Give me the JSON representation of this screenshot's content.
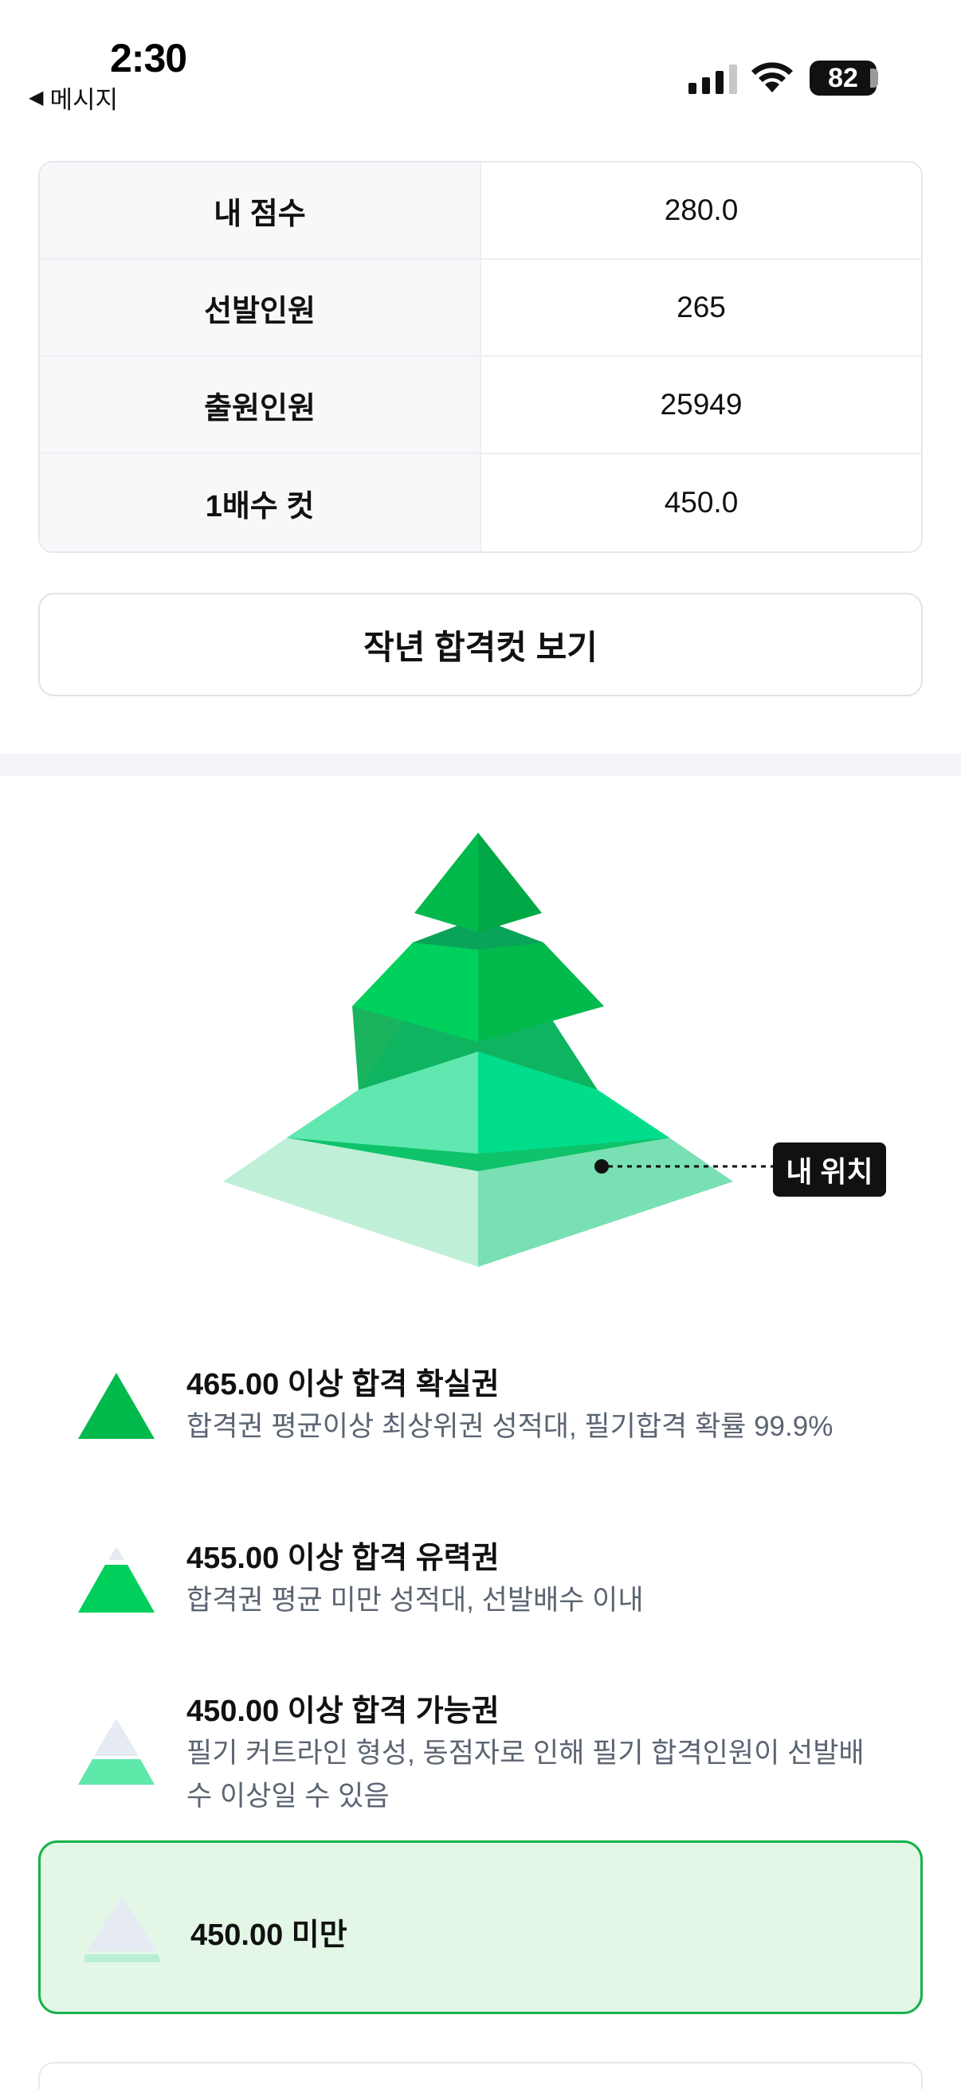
{
  "status_bar": {
    "time": "2:30",
    "back_label": "메시지",
    "battery": "82"
  },
  "score_table": [
    {
      "key": "내 점수",
      "value": "280.0"
    },
    {
      "key": "선발인원",
      "value": "265"
    },
    {
      "key": "출원인원",
      "value": "25949"
    },
    {
      "key": "1배수 컷",
      "value": "450.0"
    }
  ],
  "last_year_button": "작년 합격컷 보기",
  "pyramid": {
    "my_position_label": "내 위치"
  },
  "colors": {
    "accent": "#16b24a",
    "tier1": "#02b94c",
    "tier2": "#00cf5c",
    "tier3": "#3fe2a0",
    "tier4": "#c0efd8"
  },
  "legend": [
    {
      "title": "465.00 이상 합격 확실권",
      "desc": "합격권 평균이상 최상위권 성적대, 필기합격 확률 99.9%"
    },
    {
      "title": "455.00 이상 합격 유력권",
      "desc": "합격권 평균 미만 성적대, 선발배수 이내"
    },
    {
      "title": "450.00 이상 합격 가능권",
      "desc": "필기 커트라인 형성, 동점자로 인해 필기 합격인원이 선발배수 이상일 수 있음"
    },
    {
      "title": "450.00 미만",
      "desc": ""
    }
  ]
}
